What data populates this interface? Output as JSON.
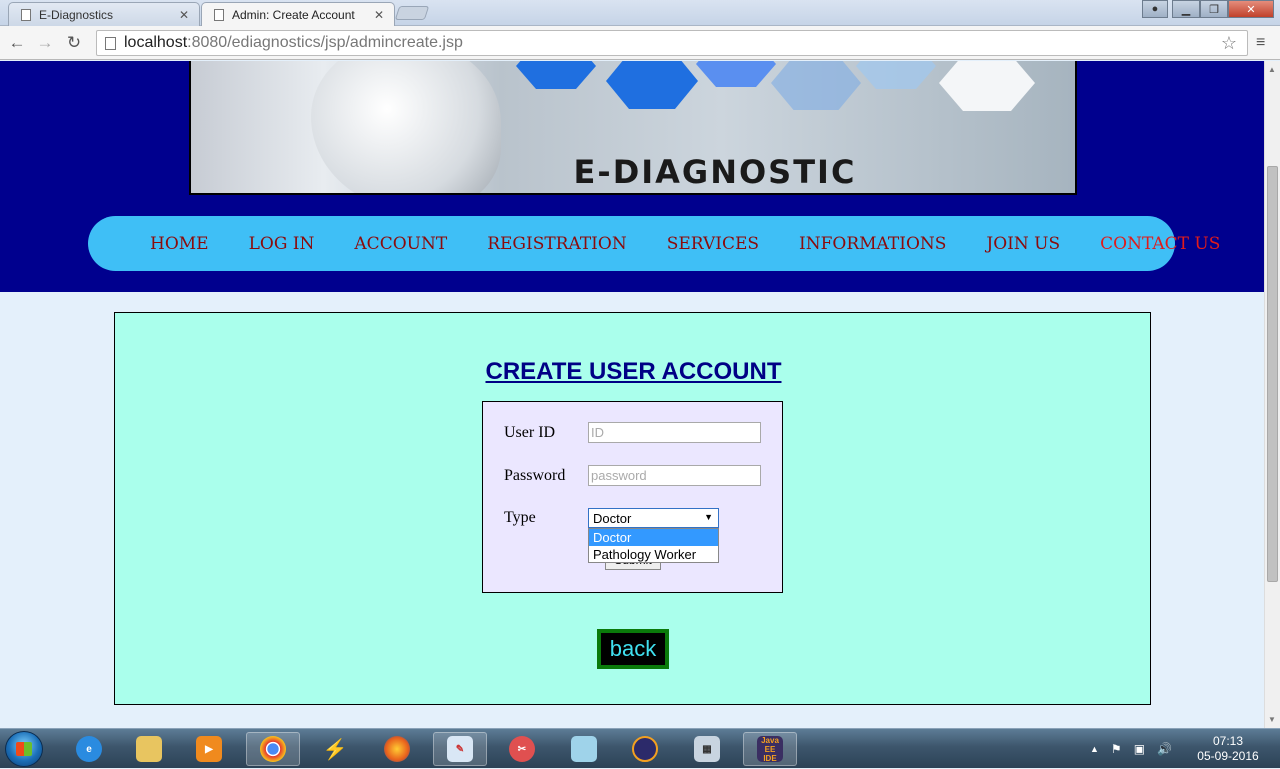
{
  "browser": {
    "tabs": [
      {
        "label": "E-Diagnostics",
        "active": false
      },
      {
        "label": "Admin: Create Account",
        "active": true
      }
    ],
    "address": {
      "host": "localhost",
      "path": ":8080/ediagnostics/jsp/admincreate.jsp"
    }
  },
  "site": {
    "banner_title": "E-DIAGNOSTIC",
    "nav": [
      {
        "label": "HOME"
      },
      {
        "label": "LOG IN"
      },
      {
        "label": "ACCOUNT"
      },
      {
        "label": "REGISTRATION"
      },
      {
        "label": "SERVICES"
      },
      {
        "label": "INFORMATIONS"
      },
      {
        "label": "JOIN US"
      },
      {
        "label": "CONTACT US"
      }
    ]
  },
  "form": {
    "title": "CREATE USER ACCOUNT",
    "userid_label": "User ID",
    "userid_placeholder": "ID",
    "password_label": "Password",
    "password_placeholder": "password",
    "type_label": "Type",
    "type_selected": "Doctor",
    "type_options": [
      "Doctor",
      "Pathology Worker"
    ],
    "submit_label": "Submit",
    "back_label": "back"
  },
  "taskbar": {
    "apps": [
      "internet-explorer",
      "file-explorer",
      "media-player",
      "chrome",
      "power-tool",
      "firefox",
      "paint",
      "snipping-tool",
      "notes",
      "eclipse",
      "calculator",
      "java-ee-ide"
    ],
    "java_label": "Java EE IDE",
    "time": "07:13",
    "date": "05-09-2016"
  },
  "colors": {
    "header_bg": "#00008e",
    "nav_bg": "#3fbff6",
    "nav_text": "#8b0b0b",
    "nav_contact": "#e01b1b",
    "panel_bg": "#aaffec",
    "form_bg": "#ebe7ff",
    "title": "#000085",
    "back_text": "#40e0f0",
    "back_border": "#0a7a0a"
  }
}
